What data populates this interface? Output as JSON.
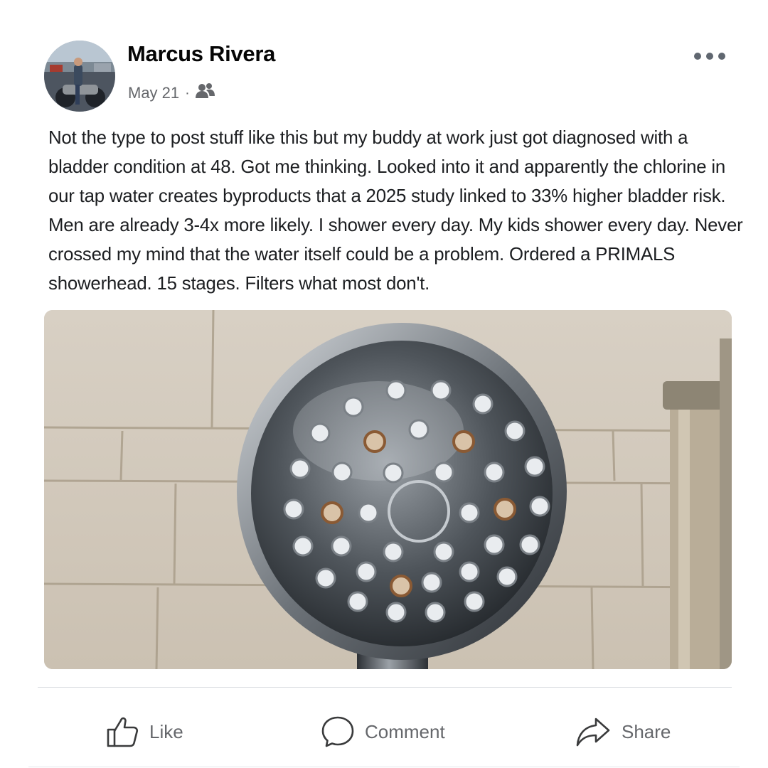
{
  "post": {
    "author": "Marcus Rivera",
    "date": "May 21",
    "separator": "·",
    "audience_icon": "friends-icon",
    "menu_icon": "more-horizontal-icon",
    "text": "Not the type to post stuff like this but my buddy at work just got diagnosed with a bladder condition at 48. Got me thinking. Looked into it and apparently the chlorine in our tap water creates byproducts that a 2025 study linked to 33% higher bladder risk. Men are already 3-4x more likely. I shower every day. My kids shower every day. Never crossed my mind that the water itself could be a problem. Ordered a PRIMALS showerhead. 15 stages. Filters what most don't."
  },
  "actions": {
    "like": {
      "label": "Like",
      "icon": "thumbs-up-icon"
    },
    "comment": {
      "label": "Comment",
      "icon": "comment-bubble-icon"
    },
    "share": {
      "label": "Share",
      "icon": "share-arrow-icon"
    }
  },
  "colors": {
    "text": "#1c1e21",
    "secondary_text": "#65676b",
    "divider": "#dadde1"
  }
}
